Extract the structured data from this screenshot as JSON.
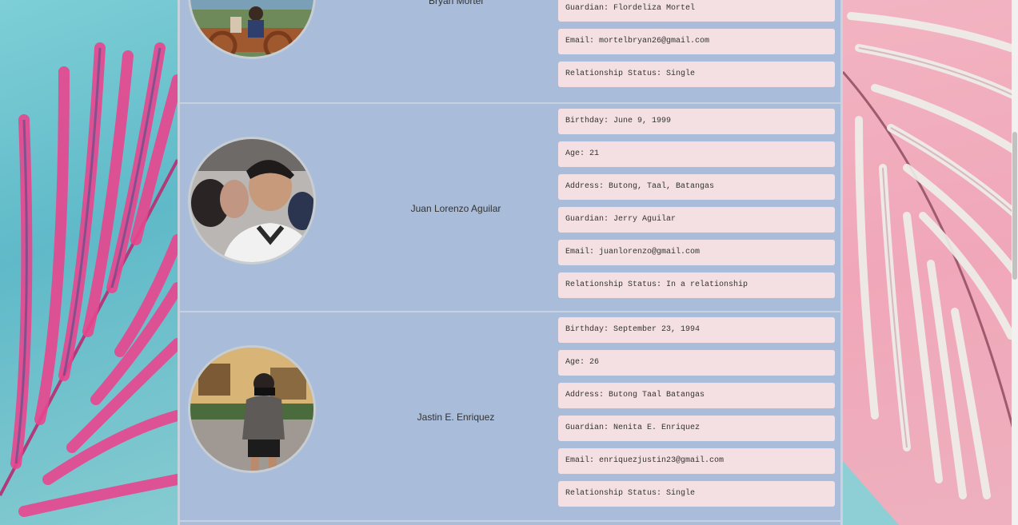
{
  "profiles": [
    {
      "name": "Bryan Mortel",
      "fields": [
        "Guardian: Flordeliza Mortel",
        "Email: mortelbryan26@gmail.com",
        "Relationship Status: Single"
      ]
    },
    {
      "name": "Juan Lorenzo Aguilar",
      "fields": [
        "Birthday: June 9, 1999",
        "Age: 21",
        "Address: Butong, Taal, Batangas",
        "Guardian: Jerry Aguilar",
        "Email: juanlorenzo@gmail.com",
        "Relationship Status: In a relationship"
      ]
    },
    {
      "name": "Jastin E. Enriquez",
      "fields": [
        "Birthday: September 23, 1994",
        "Age: 26",
        "Address: Butong Taal Batangas",
        "Guardian: Nenita E. Enriquez",
        "Email: enriquezjustin23@gmail.com",
        "Relationship Status: Single"
      ]
    }
  ],
  "colors": {
    "panel": "#a9bcd9",
    "field": "#f4e0e2",
    "left_bg": "#6fc3cf",
    "right_bg": "#f0a7b9"
  },
  "icons": [
    "palm-leaf-left",
    "palm-leaf-right"
  ]
}
